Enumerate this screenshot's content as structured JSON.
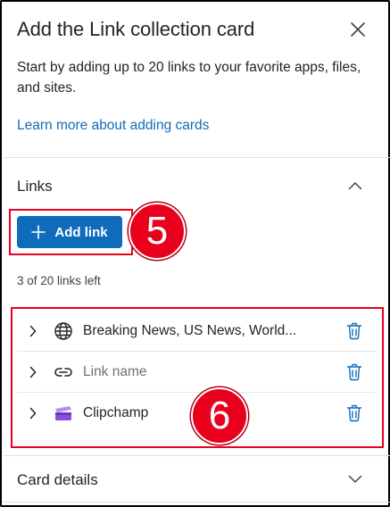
{
  "panel": {
    "title": "Add the Link collection card",
    "intro": "Start by adding up to 20 links to your favorite apps, files, and sites.",
    "learn_more": "Learn more about adding cards",
    "close_icon": "close-icon"
  },
  "links_section": {
    "heading": "Links",
    "add_button_label": "Add link",
    "count_text": "3 of 20 links left",
    "items": [
      {
        "label": "Breaking News, US News, World...",
        "icon": "globe-icon",
        "placeholder": false
      },
      {
        "label": "Link name",
        "icon": "link-icon",
        "placeholder": true
      },
      {
        "label": "Clipchamp",
        "icon": "clipchamp-icon",
        "placeholder": false
      }
    ]
  },
  "card_details": {
    "heading": "Card details"
  },
  "callouts": {
    "add_link": "5",
    "links_list": "6"
  },
  "colors": {
    "accent": "#0f6cbd",
    "callout_red": "#e8001c",
    "clipchamp_purple": "#8a4fd9"
  }
}
